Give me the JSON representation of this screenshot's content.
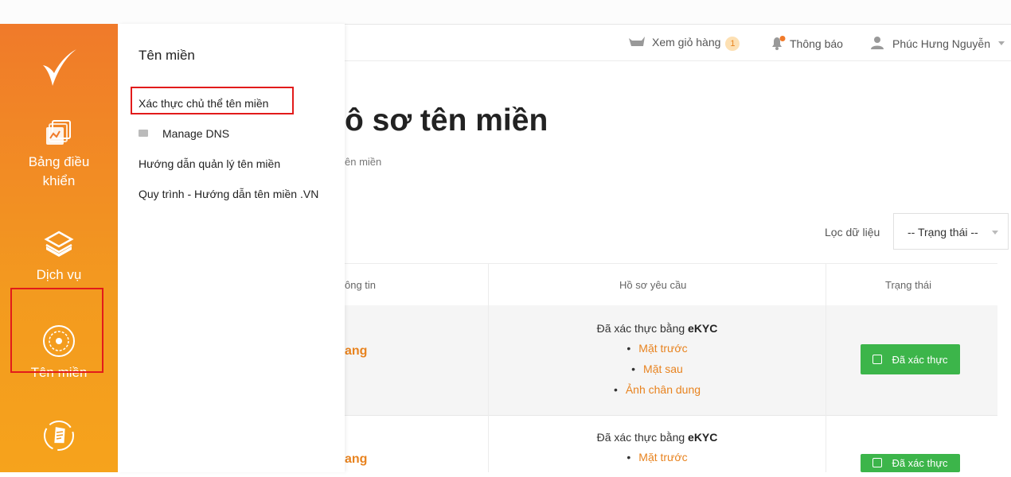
{
  "header": {
    "cart_label": "Xem giỏ hàng",
    "cart_count": "1",
    "notifications_label": "Thông báo",
    "user_name": "Phúc Hưng Nguyễn"
  },
  "sidebar": {
    "items": [
      {
        "label_line1": "Bảng điều",
        "label_line2": "khiển",
        "icon": "dashboard-icon"
      },
      {
        "label": "Dịch vụ",
        "icon": "layers-icon"
      },
      {
        "label": "Tên miền",
        "icon": "globe-icon"
      },
      {
        "icon": "document-cycle-icon"
      }
    ],
    "active_color": "#e21b1b",
    "brand_color": "#f07a2a"
  },
  "flyout": {
    "title": "Tên miền",
    "links": [
      "Xác thực chủ thể tên miền",
      "Manage DNS",
      "Hướng dẫn quản lý tên miền",
      "Quy trình - Hướng dẫn tên miền .VN"
    ]
  },
  "main": {
    "title_visible": "ô sơ tên miền",
    "breadcrumb_visible": "ên miền",
    "filter_label": "Lọc dữ liệu",
    "filter_select": "-- Trạng thái --",
    "table": {
      "columns": [
        "ông tin",
        "Hồ sơ yêu cầu",
        "Trạng thái"
      ],
      "rows": [
        {
          "name_visible": "ang",
          "req_prefix": "Đã xác thực bằng ",
          "req_method": "eKYC",
          "docs": [
            "Mặt trước",
            "Mặt sau",
            "Ảnh chân dung"
          ],
          "status": "Đã xác thực"
        },
        {
          "name_visible": "ang",
          "req_prefix": "Đã xác thực bằng ",
          "req_method": "eKYC",
          "docs": [
            "Mặt trước"
          ],
          "status": "Đã xác thực"
        }
      ]
    }
  }
}
